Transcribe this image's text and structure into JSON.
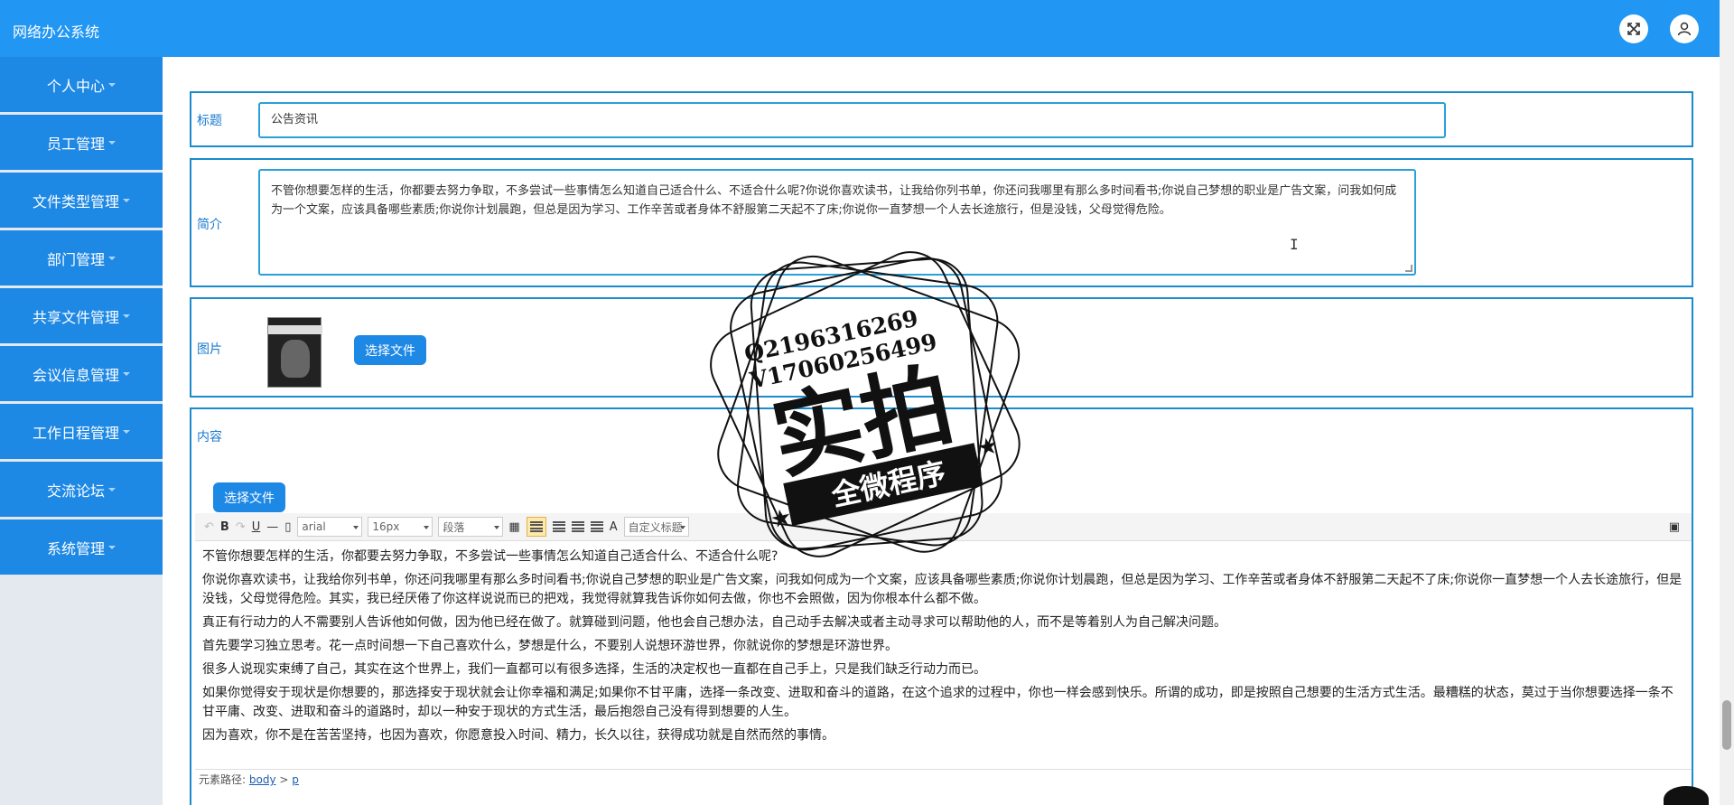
{
  "header": {
    "app_title": "网络办公系统",
    "icons": [
      "fullscreen-icon",
      "user-icon"
    ]
  },
  "sidebar": {
    "items": [
      {
        "label": "个人中心"
      },
      {
        "label": "员工管理"
      },
      {
        "label": "文件类型管理"
      },
      {
        "label": "部门管理"
      },
      {
        "label": "共享文件管理"
      },
      {
        "label": "会议信息管理"
      },
      {
        "label": "工作日程管理"
      },
      {
        "label": "交流论坛"
      },
      {
        "label": "系统管理"
      }
    ]
  },
  "form": {
    "title_label": "标题",
    "title_value": "公告资讯",
    "intro_label": "简介",
    "intro_value": "不管你想要怎样的生活，你都要去努力争取，不多尝试一些事情怎么知道自己适合什么、不适合什么呢?你说你喜欢读书，让我给你列书单，你还问我哪里有那么多时间看书;你说自己梦想的职业是广告文案，问我如何成为一个文案，应该具备哪些素质;你说你计划晨跑，但总是因为学习、工作辛苦或者身体不舒服第二天起不了床;你说你一直梦想一个人去长途旅行，但是没钱，父母觉得危险。",
    "image_label": "图片",
    "image_button": "选择文件",
    "content_label": "内容",
    "content_button": "选择文件"
  },
  "editor": {
    "font_family": "arial",
    "font_size": "16px",
    "paragraph": "段落",
    "custom_title": "自定义标题",
    "text_style_button": "A",
    "paragraphs": [
      "不管你想要怎样的生活，你都要去努力争取，不多尝试一些事情怎么知道自己适合什么、不适合什么呢?",
      "你说你喜欢读书，让我给你列书单，你还问我哪里有那么多时间看书;你说自己梦想的职业是广告文案，问我如何成为一个文案，应该具备哪些素质;你说你计划晨跑，但总是因为学习、工作辛苦或者身体不舒服第二天起不了床;你说你一直梦想一个人去长途旅行，但是没钱，父母觉得危险。其实，我已经厌倦了你这样说说而已的把戏，我觉得就算我告诉你如何去做，你也不会照做，因为你根本什么都不做。",
      "真正有行动力的人不需要别人告诉他如何做，因为他已经在做了。就算碰到问题，他也会自己想办法，自己动手去解决或者主动寻求可以帮助他的人，而不是等着别人为自己解决问题。",
      "首先要学习独立思考。花一点时间想一下自己喜欢什么，梦想是什么，不要别人说想环游世界，你就说你的梦想是环游世界。",
      "很多人说现实束缚了自己，其实在这个世界上，我们一直都可以有很多选择，生活的决定权也一直都在自己手上，只是我们缺乏行动力而已。",
      "如果你觉得安于现状是你想要的，那选择安于现状就会让你幸福和满足;如果你不甘平庸，选择一条改变、进取和奋斗的道路，在这个追求的过程中，你也一样会感到快乐。所谓的成功，即是按照自己想要的生活方式生活。最糟糕的状态，莫过于当你想要选择一条不甘平庸、改变、进取和奋斗的道路时，却以一种安于现状的方式生活，最后抱怨自己没有得到想要的人生。",
      "因为喜欢，你不是在苦苦坚持，也因为喜欢，你愿意投入时间、精力，长久以往，获得成功就是自然而然的事情。"
    ],
    "path_label": "元素路径:",
    "path_body": "body",
    "path_sep": ">",
    "path_p": "p"
  },
  "watermark": {
    "line1": "Q2196316269",
    "line2": "V17060256499",
    "big": "实拍",
    "banner": "全微程序"
  },
  "colors": {
    "primary": "#2196f3",
    "sidebar_item": "#1e88e5",
    "panel_border": "#1a8ccc"
  }
}
